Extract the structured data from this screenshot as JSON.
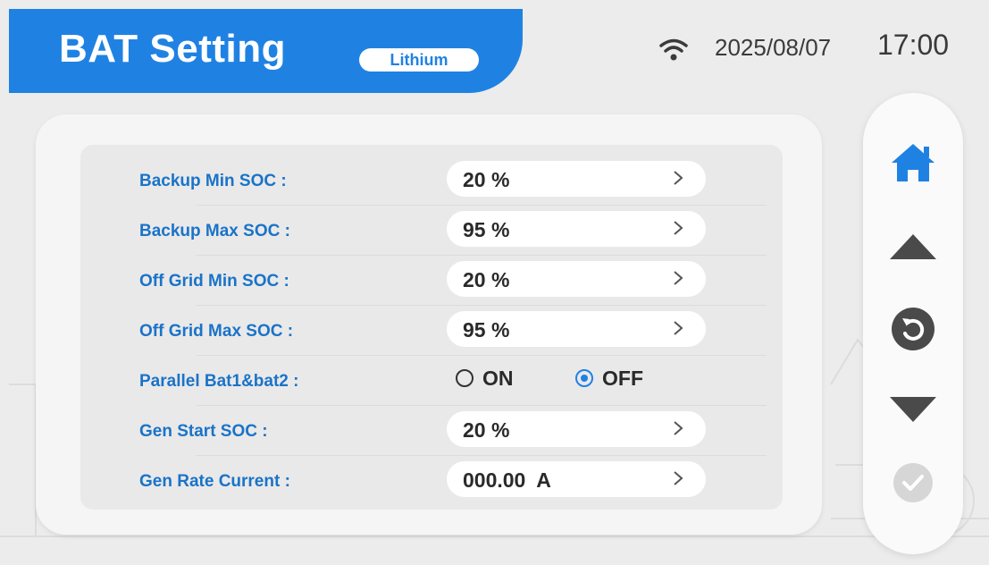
{
  "header": {
    "title": "BAT Setting",
    "badge": "Lithium",
    "wifi_icon": "wifi-icon",
    "date": "2025/08/07",
    "time": "17:00"
  },
  "settings": [
    {
      "label": "Backup Min SOC :",
      "value": "20 %"
    },
    {
      "label": "Backup Max SOC :",
      "value": "95 %"
    },
    {
      "label": "Off Grid Min SOC :",
      "value": "20 %"
    },
    {
      "label": "Off Grid Max SOC :",
      "value": "95 %"
    },
    {
      "label": "Parallel Bat1&bat2 :",
      "options": [
        "ON",
        "OFF"
      ],
      "selected": "OFF"
    },
    {
      "label": "Gen Start SOC :",
      "value": "20 %"
    },
    {
      "label": "Gen Rate Current :",
      "value": "000.00  A"
    }
  ],
  "sidebar": {
    "icons": [
      "home-icon",
      "arrow-up-icon",
      "back-icon",
      "arrow-down-icon",
      "confirm-icon"
    ]
  },
  "colors": {
    "accent": "#1f82e3",
    "label_blue": "#1a73c8",
    "icon_dark": "#4a4a4a",
    "confirm_disabled": "#d6d6d6"
  }
}
